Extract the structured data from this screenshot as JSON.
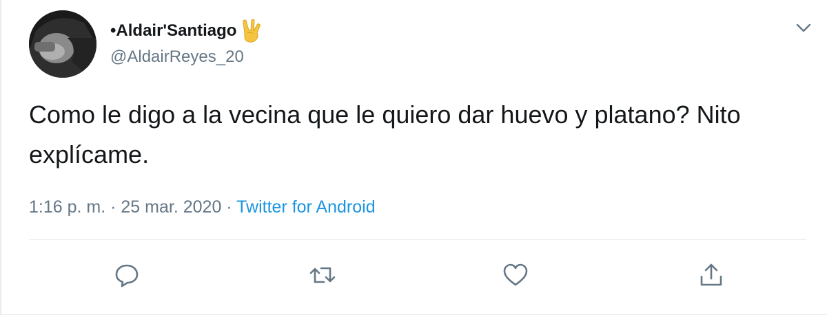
{
  "user": {
    "display_name": "•Aldair'Santiago",
    "badge_emoji": "victory-hand-emoji",
    "handle": "@AldairReyes_20",
    "avatar": "user-avatar"
  },
  "tweet": {
    "text": "Como le digo a la vecina que le quiero dar huevo y platano? Nito explícame.",
    "time": "1:16 p. m.",
    "separator": "·",
    "date": "25 mar. 2020",
    "source": "Twitter for Android"
  },
  "actions": [
    {
      "name": "reply",
      "icon": "comment-icon"
    },
    {
      "name": "retweet",
      "icon": "retweet-icon"
    },
    {
      "name": "like",
      "icon": "heart-icon"
    },
    {
      "name": "share",
      "icon": "share-icon"
    }
  ],
  "colors": {
    "text_primary": "#14171a",
    "text_secondary": "#657786",
    "link": "#1b95e0",
    "divider": "#e6ecf0",
    "icon": "#657786"
  }
}
